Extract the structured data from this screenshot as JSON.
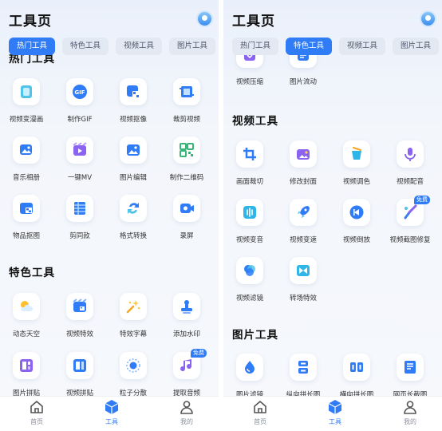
{
  "left": {
    "title": "工具页",
    "tabs": [
      "热门工具",
      "特色工具",
      "视频工具",
      "图片工具"
    ],
    "hot_title": "热门工具",
    "hot_items": [
      {
        "label": "视频变漫画",
        "icon": "comic-video-icon"
      },
      {
        "label": "制作GIF",
        "icon": "gif-icon"
      },
      {
        "label": "视频抠像",
        "icon": "video-cutout-icon"
      },
      {
        "label": "裁剪视频",
        "icon": "crop-video-icon"
      },
      {
        "label": "音乐相册",
        "icon": "music-album-icon"
      },
      {
        "label": "一键MV",
        "icon": "one-click-mv-icon"
      },
      {
        "label": "图片编辑",
        "icon": "image-edit-icon"
      },
      {
        "label": "制作二维码",
        "icon": "qr-code-icon"
      },
      {
        "label": "物品抠图",
        "icon": "object-cutout-icon"
      },
      {
        "label": "剪同款",
        "icon": "template-icon"
      },
      {
        "label": "格式转换",
        "icon": "format-convert-icon"
      },
      {
        "label": "录屏",
        "icon": "screen-record-icon"
      }
    ],
    "feature_title": "特色工具",
    "feature_items": [
      {
        "label": "动态天空",
        "icon": "dynamic-sky-icon"
      },
      {
        "label": "视频特效",
        "icon": "video-effects-icon"
      },
      {
        "label": "特效字幕",
        "icon": "effect-subtitle-icon"
      },
      {
        "label": "添加水印",
        "icon": "watermark-icon"
      },
      {
        "label": "图片拼贴",
        "icon": "image-collage-icon"
      },
      {
        "label": "视频拼贴",
        "icon": "video-collage-icon"
      },
      {
        "label": "粒子分散",
        "icon": "particle-icon"
      },
      {
        "label": "提取音频",
        "icon": "extract-audio-icon",
        "badge": "免费"
      }
    ]
  },
  "right": {
    "title": "工具页",
    "tabs": [
      "热门工具",
      "特色工具",
      "视频工具",
      "图片工具"
    ],
    "partial_items": [
      {
        "label": "视频压缩",
        "icon": "video-compress-icon"
      },
      {
        "label": "图片流动",
        "icon": "image-flow-icon"
      }
    ],
    "video_title": "视频工具",
    "video_items": [
      {
        "label": "画面裁切",
        "icon": "frame-crop-icon"
      },
      {
        "label": "修改封面",
        "icon": "cover-edit-icon"
      },
      {
        "label": "视频调色",
        "icon": "color-grade-icon"
      },
      {
        "label": "视频配音",
        "icon": "dubbing-icon"
      },
      {
        "label": "视频变音",
        "icon": "voice-change-icon"
      },
      {
        "label": "视频变速",
        "icon": "speed-icon"
      },
      {
        "label": "视频倒放",
        "icon": "reverse-icon"
      },
      {
        "label": "视频截图修复",
        "icon": "screenshot-repair-icon",
        "badge": "免费"
      },
      {
        "label": "视频滤镜",
        "icon": "video-filter-icon"
      },
      {
        "label": "转场特效",
        "icon": "transition-icon"
      }
    ],
    "image_title": "图片工具",
    "image_items": [
      {
        "label": "图片滤镜",
        "icon": "image-filter-icon"
      },
      {
        "label": "纵向拼长图",
        "icon": "vertical-stitch-icon"
      },
      {
        "label": "横向拼长图",
        "icon": "horizontal-stitch-icon"
      },
      {
        "label": "网页长截图",
        "icon": "webpage-screenshot-icon"
      }
    ]
  },
  "nav": [
    {
      "label": "首页",
      "icon": "home-icon"
    },
    {
      "label": "工具",
      "icon": "tools-icon"
    },
    {
      "label": "我的",
      "icon": "profile-icon"
    }
  ],
  "colors": {
    "accent": "#2f7cf6",
    "tab_bg": "#e3e9f3",
    "text": "#111111"
  }
}
